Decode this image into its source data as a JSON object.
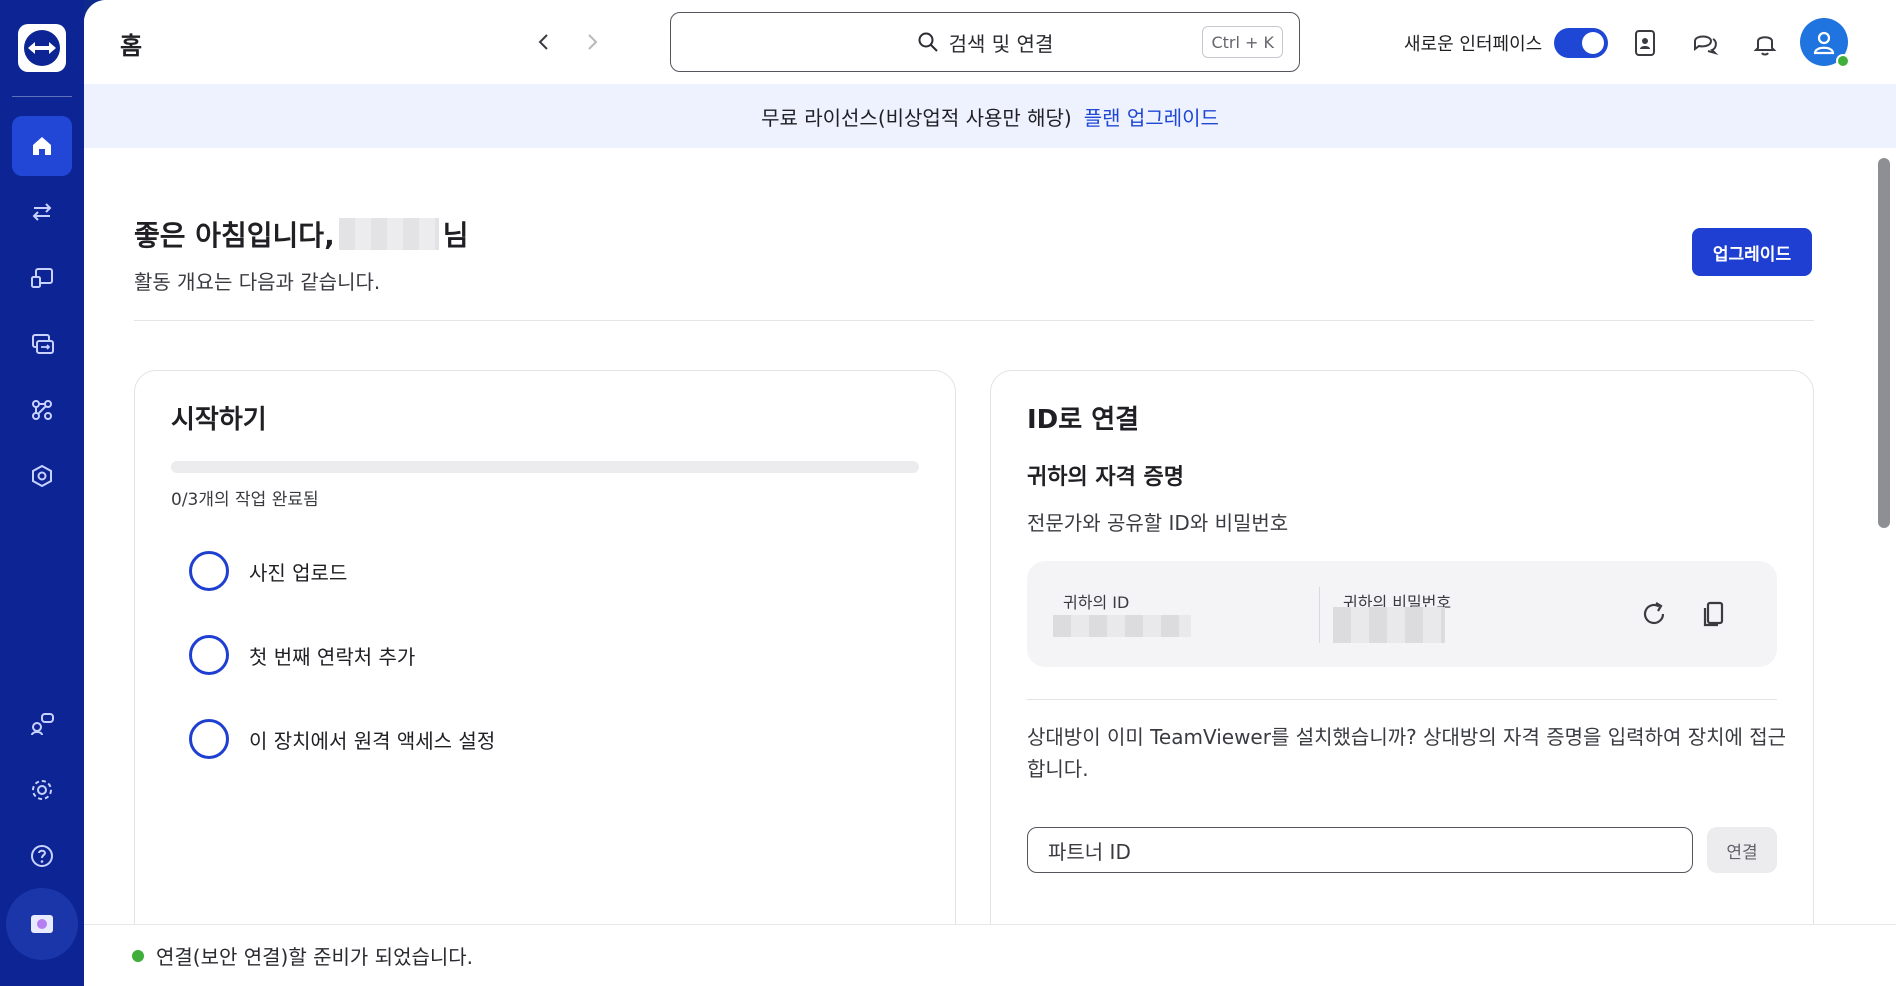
{
  "header": {
    "title": "홈",
    "search_text": "검색 및 연결",
    "search_shortcut": "Ctrl + K",
    "new_ui_label": "새로운 인터페이스"
  },
  "banner": {
    "text": "무료 라이선스(비상업적 사용만 해당)",
    "link": "플랜 업그레이드"
  },
  "welcome": {
    "greeting_prefix": "좋은 아침입니다,",
    "greeting_suffix": "님",
    "subtitle": "활동 개요는 다음과 같습니다.",
    "upgrade_button": "업그레이드"
  },
  "getting_started": {
    "title": "시작하기",
    "progress_fraction": 0,
    "progress_text": "0/3개의 작업 완료됨",
    "tasks": [
      {
        "label": "사진 업로드"
      },
      {
        "label": "첫 번째 연락처 추가"
      },
      {
        "label": "이 장치에서 원격 액세스 설정"
      }
    ]
  },
  "connect": {
    "title": "ID로 연결",
    "credentials_title": "귀하의 자격 증명",
    "credentials_subtitle": "전문가와 공유할 ID와 비밀번호",
    "id_label": "귀하의 ID",
    "password_label": "귀하의 비밀번호",
    "partner_text": "상대방이 이미 TeamViewer를 설치했습니까? 상대방의 자격 증명을 입력하여 장치에 접근합니다.",
    "partner_placeholder": "파트너 ID",
    "connect_button": "연결"
  },
  "status": {
    "text": "연결(보안 연결)할 준비가 되었습니다."
  },
  "colors": {
    "sidebar": "#0c2494",
    "accent": "#1f47d6",
    "status_ok": "#3fae3a"
  }
}
